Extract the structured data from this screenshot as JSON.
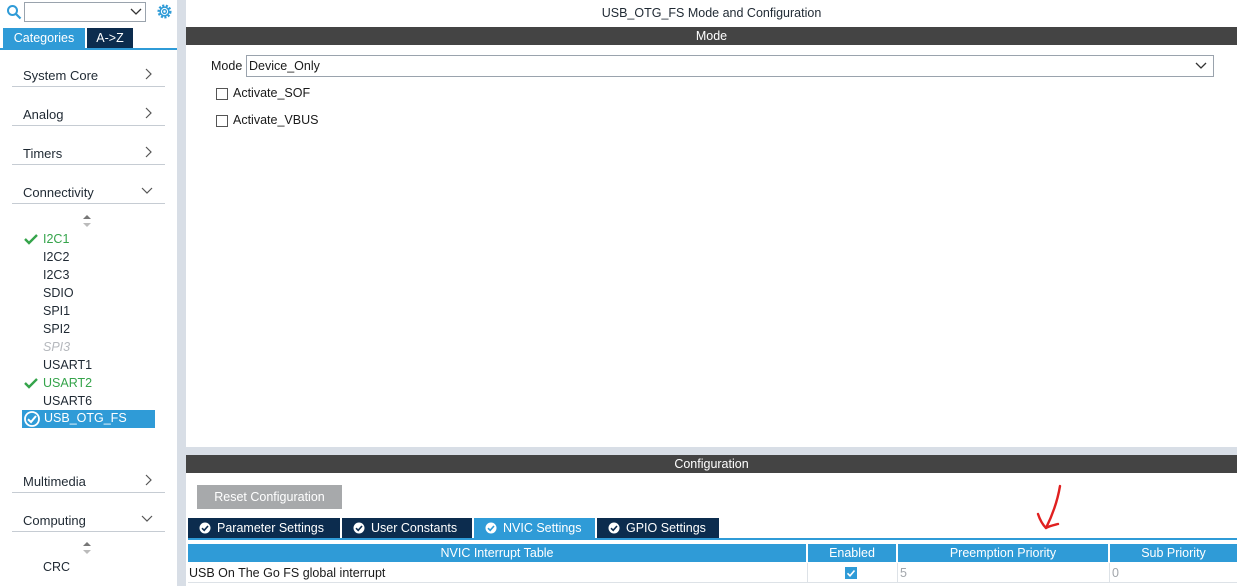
{
  "sidebar": {
    "search": {
      "value": ""
    },
    "tabs": [
      {
        "label": "Categories"
      },
      {
        "label": "A->Z"
      }
    ],
    "categories": [
      {
        "label": "System Core",
        "expanded": false
      },
      {
        "label": "Analog",
        "expanded": false
      },
      {
        "label": "Timers",
        "expanded": false
      },
      {
        "label": "Connectivity",
        "expanded": true
      },
      {
        "label": "Multimedia",
        "expanded": false
      },
      {
        "label": "Computing",
        "expanded": true
      }
    ],
    "connectivity_items": [
      {
        "label": "I2C1",
        "state": "configured"
      },
      {
        "label": "I2C2",
        "state": "normal"
      },
      {
        "label": "I2C3",
        "state": "normal"
      },
      {
        "label": "SDIO",
        "state": "normal"
      },
      {
        "label": "SPI1",
        "state": "normal"
      },
      {
        "label": "SPI2",
        "state": "normal"
      },
      {
        "label": "SPI3",
        "state": "disabled"
      },
      {
        "label": "USART1",
        "state": "normal"
      },
      {
        "label": "USART2",
        "state": "configured"
      },
      {
        "label": "USART6",
        "state": "normal"
      },
      {
        "label": "USB_OTG_FS",
        "state": "selected"
      }
    ],
    "computing_items": [
      {
        "label": "CRC",
        "state": "normal"
      }
    ]
  },
  "main": {
    "title": "USB_OTG_FS Mode and Configuration",
    "mode_section": {
      "header": "Mode",
      "mode_label": "Mode",
      "mode_value": "Device_Only",
      "checkboxes": [
        {
          "label": "Activate_SOF",
          "checked": false
        },
        {
          "label": "Activate_VBUS",
          "checked": false
        }
      ]
    },
    "config_section": {
      "header": "Configuration",
      "reset_label": "Reset Configuration",
      "tabs": [
        {
          "label": "Parameter Settings",
          "active": false
        },
        {
          "label": "User Constants",
          "active": false
        },
        {
          "label": "NVIC Settings",
          "active": true
        },
        {
          "label": "GPIO Settings",
          "active": false
        }
      ],
      "nvic_table": {
        "headers": [
          "NVIC Interrupt Table",
          "Enabled",
          "Preemption Priority",
          "Sub Priority"
        ],
        "rows": [
          {
            "name": "USB On The Go FS global interrupt",
            "enabled": true,
            "preemption": "5",
            "sub": "0"
          }
        ]
      }
    }
  },
  "colors": {
    "accent": "#2f9bd7",
    "dark_tab": "#0c2c4e",
    "section_bar": "#444444",
    "configured_green": "#35a44b",
    "annotation_red": "#e02020"
  },
  "icons": {
    "search": "search-icon",
    "settings": "gear-icon",
    "expand": "chevron-right-icon",
    "collapse": "chevron-down-icon",
    "configured": "check-icon",
    "tab_status": "check-circle-icon"
  }
}
